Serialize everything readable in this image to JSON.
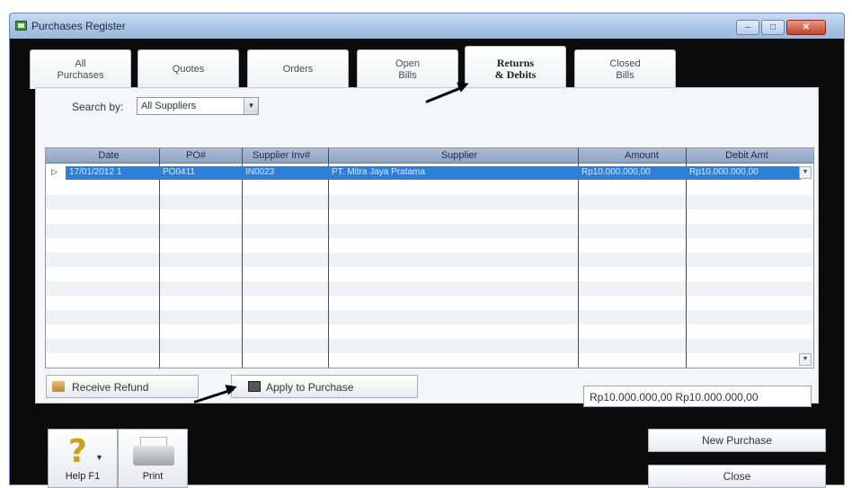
{
  "window": {
    "title": "Purchases Register"
  },
  "tabs": [
    {
      "label": "All\nPurchases",
      "active": false
    },
    {
      "label": "Quotes",
      "active": false
    },
    {
      "label": "Orders",
      "active": false
    },
    {
      "label": "Open\nBills",
      "active": false
    },
    {
      "label": "Returns\n& Debits",
      "active": true
    },
    {
      "label": "Closed\nBills",
      "active": false
    }
  ],
  "search": {
    "label": "Search by:",
    "selected": "All Suppliers"
  },
  "grid": {
    "columns": [
      "Date",
      "PO#",
      "Supplier Inv#",
      "Supplier",
      "Amount",
      "Debit Amt"
    ],
    "rows": [
      {
        "date": "17/01/2012 1",
        "po": "PO0411",
        "supplier_inv": "IN0023",
        "supplier": "PT. Mitra Jaya Pratama",
        "amount": "Rp10.000.000,00",
        "debit_amt": "Rp10.000.000,00"
      }
    ]
  },
  "buttons": {
    "receive_refund": "Receive Refund",
    "apply_purchase": "Apply to Purchase",
    "help": "Help F1",
    "print": "Print",
    "new_purchase": "New Purchase",
    "close": "Close"
  },
  "totals": {
    "text": "Rp10.000.000,00 Rp10.000.000,00"
  },
  "colors": {
    "selection": "#2f7fd7",
    "titlebar": "#a8c3e4",
    "window_frame": "#0b0b0b"
  }
}
